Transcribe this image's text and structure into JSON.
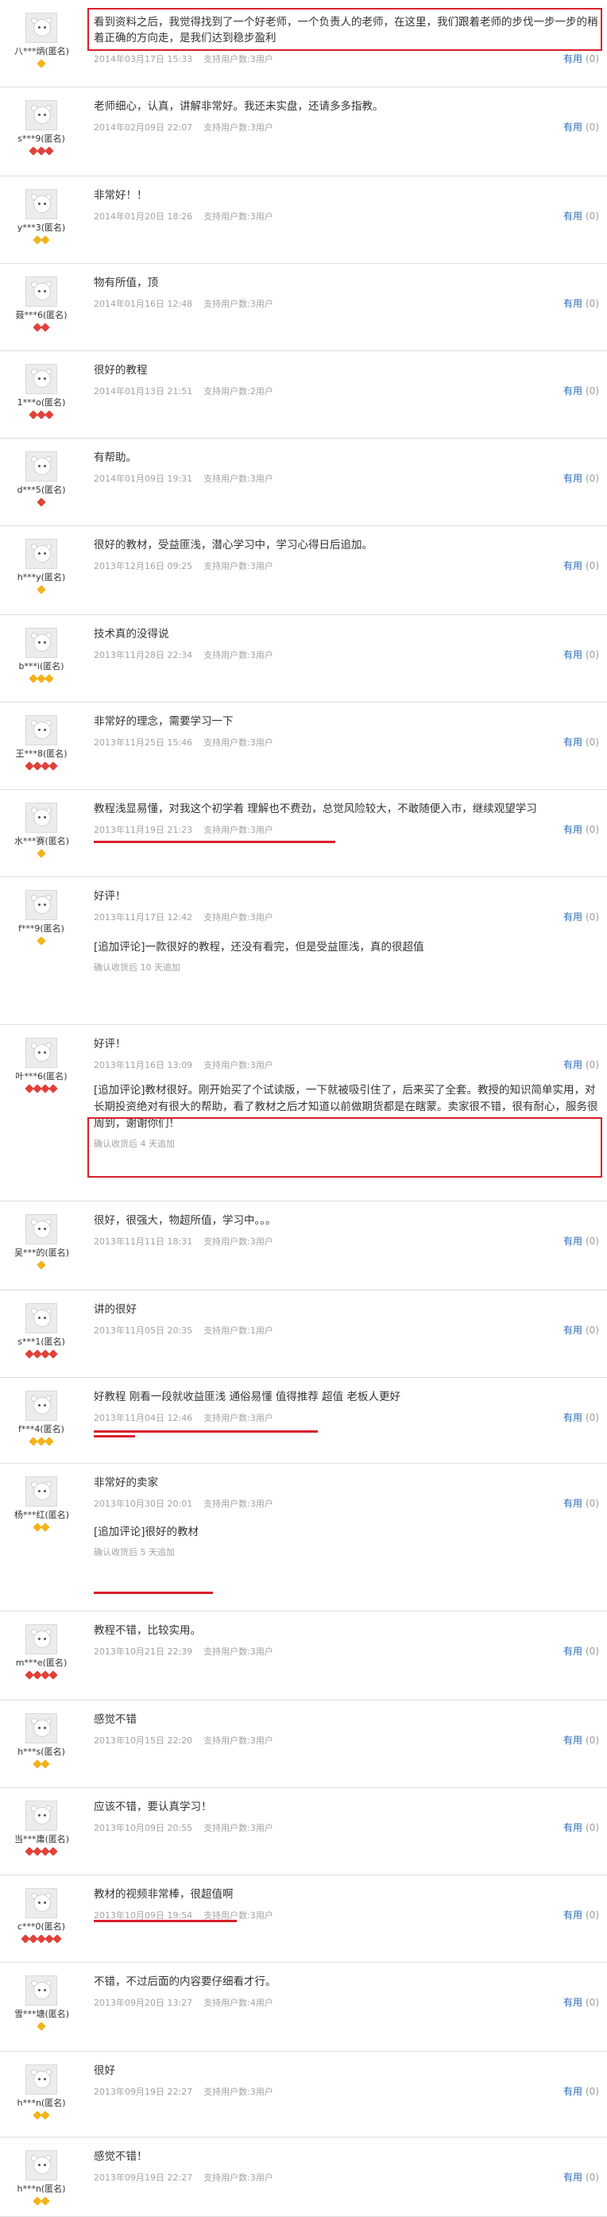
{
  "useful_label": "有用",
  "useful_count": "(0)",
  "reviews": [
    {
      "user": "八***炳(匿名)",
      "badge": "gold",
      "badge_count": 1,
      "text": "看到资料之后，我觉得找到了一个好老师，一个负责人的老师，在这里，我们跟着老师的步伐一步一步的稍着正确的方向走，是我们达到稳步盈利",
      "date": "2014年03月17日 15:33",
      "support": "支持用户数:3用户"
    },
    {
      "user": "s***9(匿名)",
      "badge": "red",
      "badge_count": 3,
      "text": "老师细心，认真，讲解非常好。我还未实盘，还请多多指教。",
      "date": "2014年02月09日 22:07",
      "support": "支持用户数:3用户"
    },
    {
      "user": "y***3(匿名)",
      "badge": "gold",
      "badge_count": 2,
      "text": "非常好！！",
      "date": "2014年01月20日 18:26",
      "support": "支持用户数:3用户"
    },
    {
      "user": "聂***6(匿名)",
      "badge": "red",
      "badge_count": 2,
      "text": "物有所值，顶",
      "date": "2014年01月16日 12:48",
      "support": "支持用户数:3用户"
    },
    {
      "user": "1***o(匿名)",
      "badge": "red",
      "badge_count": 3,
      "text": "很好的教程",
      "date": "2014年01月13日 21:51",
      "support": "支持用户数:2用户"
    },
    {
      "user": "d***5(匿名)",
      "badge": "red",
      "badge_count": 1,
      "text": "有帮助。",
      "date": "2014年01月09日 19:31",
      "support": "支持用户数:3用户"
    },
    {
      "user": "h***y(匿名)",
      "badge": "gold",
      "badge_count": 1,
      "text": "很好的教材，受益匪浅，潜心学习中，学习心得日后追加。",
      "date": "2013年12月16日 09:25",
      "support": "支持用户数:3用户"
    },
    {
      "user": "b***i(匿名)",
      "badge": "gold",
      "badge_count": 3,
      "text": "技术真的没得说",
      "date": "2013年11月28日 22:34",
      "support": "支持用户数:3用户"
    },
    {
      "user": "王***8(匿名)",
      "badge": "red",
      "badge_count": 4,
      "text": "非常好的理念，需要学习一下",
      "date": "2013年11月25日 15:46",
      "support": "支持用户数:3用户"
    },
    {
      "user": "水***赛(匿名)",
      "badge": "gold",
      "badge_count": 1,
      "text": "教程浅显易懂，对我这个初学着 理解也不费劲，总觉风险较大，不敢随便入市，继续观望学习",
      "date": "2013年11月19日 21:23",
      "support": "支持用户数:3用户"
    },
    {
      "user": "f***9(匿名)",
      "badge": "gold",
      "badge_count": 1,
      "text": "好评！",
      "date": "2013年11月17日 12:42",
      "support": "支持用户数:3用户",
      "follow": "[追加评论]一款很好的教程，还没有看完，但是受益匪浅，真的很超值",
      "follow_meta": "确认收货后 10 天追加"
    },
    {
      "user": "叶***6(匿名)",
      "badge": "red",
      "badge_count": 4,
      "text": "好评！",
      "date": "2013年11月16日 13:09",
      "support": "支持用户数:3用户",
      "follow": "[追加评论]教材很好。刚开始买了个试读版，一下就被吸引住了，后来买了全套。教授的知识简单实用，对长期投资绝对有很大的帮助，看了教材之后才知道以前做期货都是在瞎蒙。卖家很不错，很有耐心，服务很周到，谢谢你们！",
      "follow_meta": "确认收货后 4 天追加"
    },
    {
      "user": "吴***的(匿名)",
      "badge": "gold",
      "badge_count": 1,
      "text": "很好，很强大，物超所值，学习中。。。",
      "date": "2013年11月11日 18:31",
      "support": "支持用户数:3用户"
    },
    {
      "user": "s***1(匿名)",
      "badge": "red",
      "badge_count": 4,
      "text": "讲的很好",
      "date": "2013年11月05日 20:35",
      "support": "支持用户数:1用户"
    },
    {
      "user": "f***4(匿名)",
      "badge": "gold",
      "badge_count": 3,
      "text": "好教程 刚看一段就收益匪浅 通俗易懂 值得推荐 超值 老板人更好",
      "date": "2013年11月04日 12:46",
      "support": "支持用户数:3用户"
    },
    {
      "user": "杨***红(匿名)",
      "badge": "gold",
      "badge_count": 2,
      "text": "非常好的卖家",
      "date": "2013年10月30日 20:01",
      "support": "支持用户数:3用户",
      "follow": "[追加评论]很好的教材",
      "follow_meta": "确认收货后 5 天追加"
    },
    {
      "user": "m***e(匿名)",
      "badge": "red",
      "badge_count": 4,
      "text": "教程不错，比较实用。",
      "date": "2013年10月21日 22:39",
      "support": "支持用户数:3用户"
    },
    {
      "user": "h***s(匿名)",
      "badge": "gold",
      "badge_count": 2,
      "text": "感觉不错",
      "date": "2013年10月15日 22:20",
      "support": "支持用户数:3用户"
    },
    {
      "user": "当***庸(匿名)",
      "badge": "red",
      "badge_count": 4,
      "text": "应该不错，要认真学习！",
      "date": "2013年10月09日 20:55",
      "support": "支持用户数:3用户"
    },
    {
      "user": "c***0(匿名)",
      "badge": "red",
      "badge_count": 5,
      "text": "教材的视频非常棒，很超值啊",
      "date": "2013年10月09日 19:54",
      "support": "支持用户数:3用户"
    },
    {
      "user": "雪***塘(匿名)",
      "badge": "gold",
      "badge_count": 1,
      "text": "不错，不过后面的内容要仔细看才行。",
      "date": "2013年09月20日 13:27",
      "support": "支持用户数:4用户"
    },
    {
      "user": "h***n(匿名)",
      "badge": "gold",
      "badge_count": 2,
      "text": "很好",
      "date": "2013年09月19日 22:27",
      "support": "支持用户数:3用户"
    },
    {
      "user": "h***n(匿名)",
      "badge": "gold",
      "badge_count": 2,
      "text": "感觉不错！",
      "date": "2013年09月19日 22:27",
      "support": "支持用户数:3用户"
    }
  ]
}
